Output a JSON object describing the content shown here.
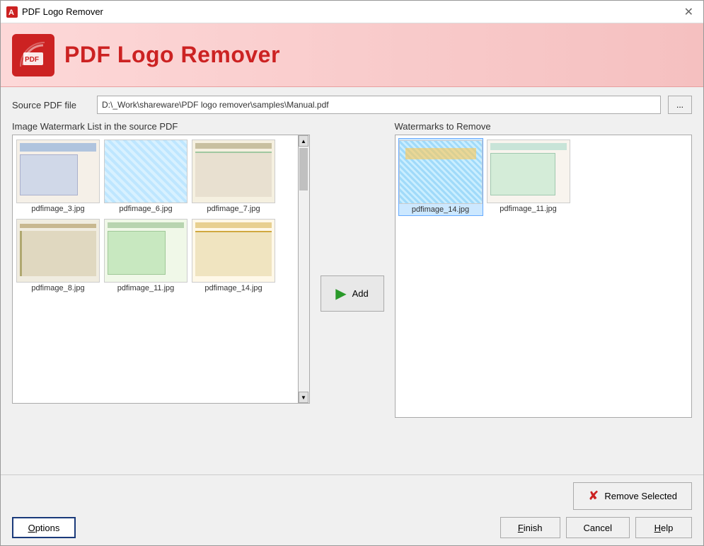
{
  "window": {
    "title": "PDF Logo Remover",
    "close_label": "✕"
  },
  "header": {
    "title": "PDF Logo Remover"
  },
  "source": {
    "label": "Source PDF file",
    "value": "D:\\_Work\\shareware\\PDF logo remover\\samples\\Manual.pdf",
    "browse_label": "..."
  },
  "left_panel": {
    "label": "Image Watermark List in the source PDF",
    "items": [
      {
        "id": "pdfimage_3",
        "label": "pdfimage_3.jpg"
      },
      {
        "id": "pdfimage_6",
        "label": "pdfimage_6.jpg"
      },
      {
        "id": "pdfimage_7",
        "label": "pdfimage_7.jpg"
      },
      {
        "id": "pdfimage_8",
        "label": "pdfimage_8.jpg"
      },
      {
        "id": "pdfimage_11",
        "label": "pdfimage_11.jpg"
      },
      {
        "id": "pdfimage_14",
        "label": "pdfimage_14.jpg"
      }
    ]
  },
  "add_button": {
    "label": "Add"
  },
  "right_panel": {
    "label": "Watermarks to Remove",
    "items": [
      {
        "id": "pdfimage_14",
        "label": "pdfimage_14.jpg"
      },
      {
        "id": "pdfimage_11",
        "label": "pdfimage_11.jpg"
      }
    ]
  },
  "remove_button": {
    "label": "Remove Selected"
  },
  "footer": {
    "options_label": "Options",
    "finish_label": "Finish",
    "cancel_label": "Cancel",
    "help_label": "Help"
  }
}
